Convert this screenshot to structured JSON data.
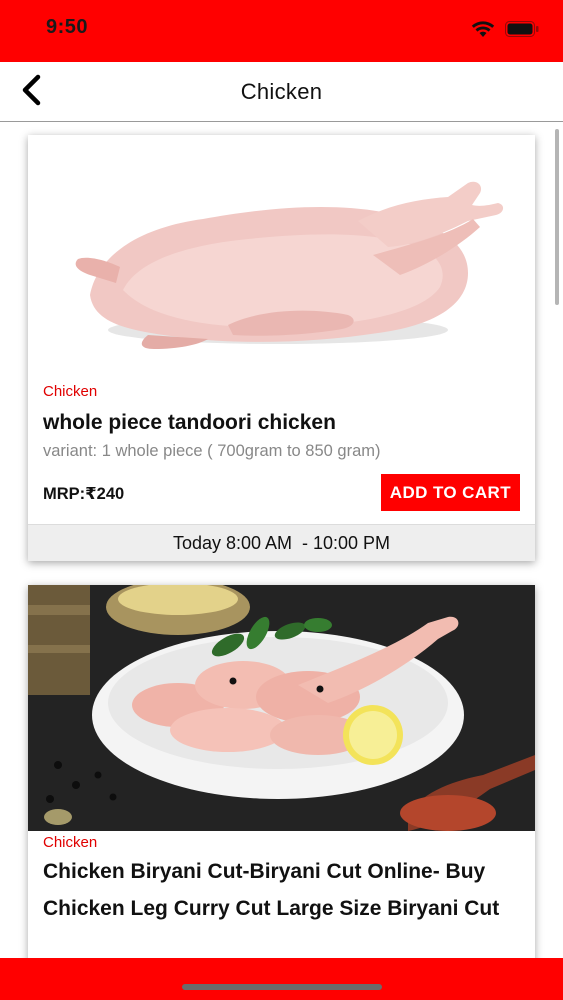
{
  "status_bar": {
    "time": "9:50",
    "wifi_icon": "wifi-icon",
    "battery_icon": "battery-icon",
    "background": "#ff0000"
  },
  "nav": {
    "title": "Chicken",
    "back_icon": "chevron-left-icon"
  },
  "products": [
    {
      "category": "Chicken",
      "name": "whole piece tandoori chicken",
      "variant": "variant: 1 whole piece ( 700gram to 850 gram)",
      "price": "MRP:₹240",
      "button": "ADD TO CART",
      "timing": "Today 8:00 AM  - 10:00 PM"
    },
    {
      "category": "Chicken",
      "name": "Chicken Biryani Cut-Biryani Cut Online- Buy Chicken Leg Curry Cut Large Size Biryani Cut"
    }
  ],
  "theme": {
    "accent": "#ff0000",
    "category_color": "#e00000",
    "muted_text": "#888888"
  }
}
